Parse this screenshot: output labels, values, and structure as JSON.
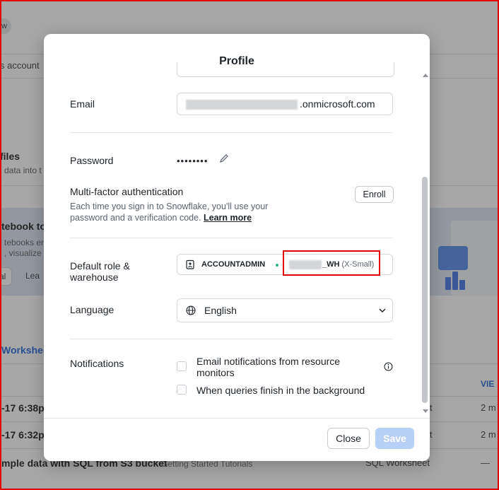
{
  "background": {
    "pill": "w",
    "account_text": "s account",
    "section_title": "files",
    "section_desc": "data into t",
    "banner_title": "tebook to",
    "banner_line1": "tebooks en",
    "banner_line2": ", visualize r",
    "banner_btn1": "al",
    "banner_btn2": "Lea",
    "worksheets_title": "Workshee",
    "col_viewed": "VIE",
    "rows": [
      {
        "date": "-17 6:38p",
        "type": "t",
        "viewed": "2 m"
      },
      {
        "date": "-17 6:32p",
        "type": "t",
        "viewed": "2 m"
      },
      {
        "name": "mple data with SQL from S3 bucket",
        "folder": "Getting Started Tutorials",
        "type": "SQL Worksheet",
        "viewed": "—"
      }
    ]
  },
  "modal": {
    "title": "Profile",
    "email": {
      "label": "Email",
      "value_suffix": ".onmicrosoft.com"
    },
    "password": {
      "label": "Password",
      "value": "••••••••"
    },
    "mfa": {
      "label": "Multi-factor authentication",
      "desc": "Each time you sign in to Snowflake, you'll use your password and a verification code.",
      "link": "Learn more",
      "button": "Enroll"
    },
    "default_role": {
      "label_line1": "Default role &",
      "label_line2": "warehouse",
      "role": "ACCOUNTADMIN",
      "warehouse_suffix": "_WH",
      "warehouse_size": "(X-Small)"
    },
    "language": {
      "label": "Language",
      "value": "English"
    },
    "notifications": {
      "label": "Notifications",
      "option1_line1": "Email notifications from resource",
      "option1_line2": "monitors",
      "option2": "When queries finish in the background"
    },
    "footer": {
      "close": "Close",
      "save": "Save"
    }
  },
  "colors": {
    "accent": "#1a5fd6",
    "highlight": "#e00000",
    "save_disabled": "#b7d0f5"
  }
}
